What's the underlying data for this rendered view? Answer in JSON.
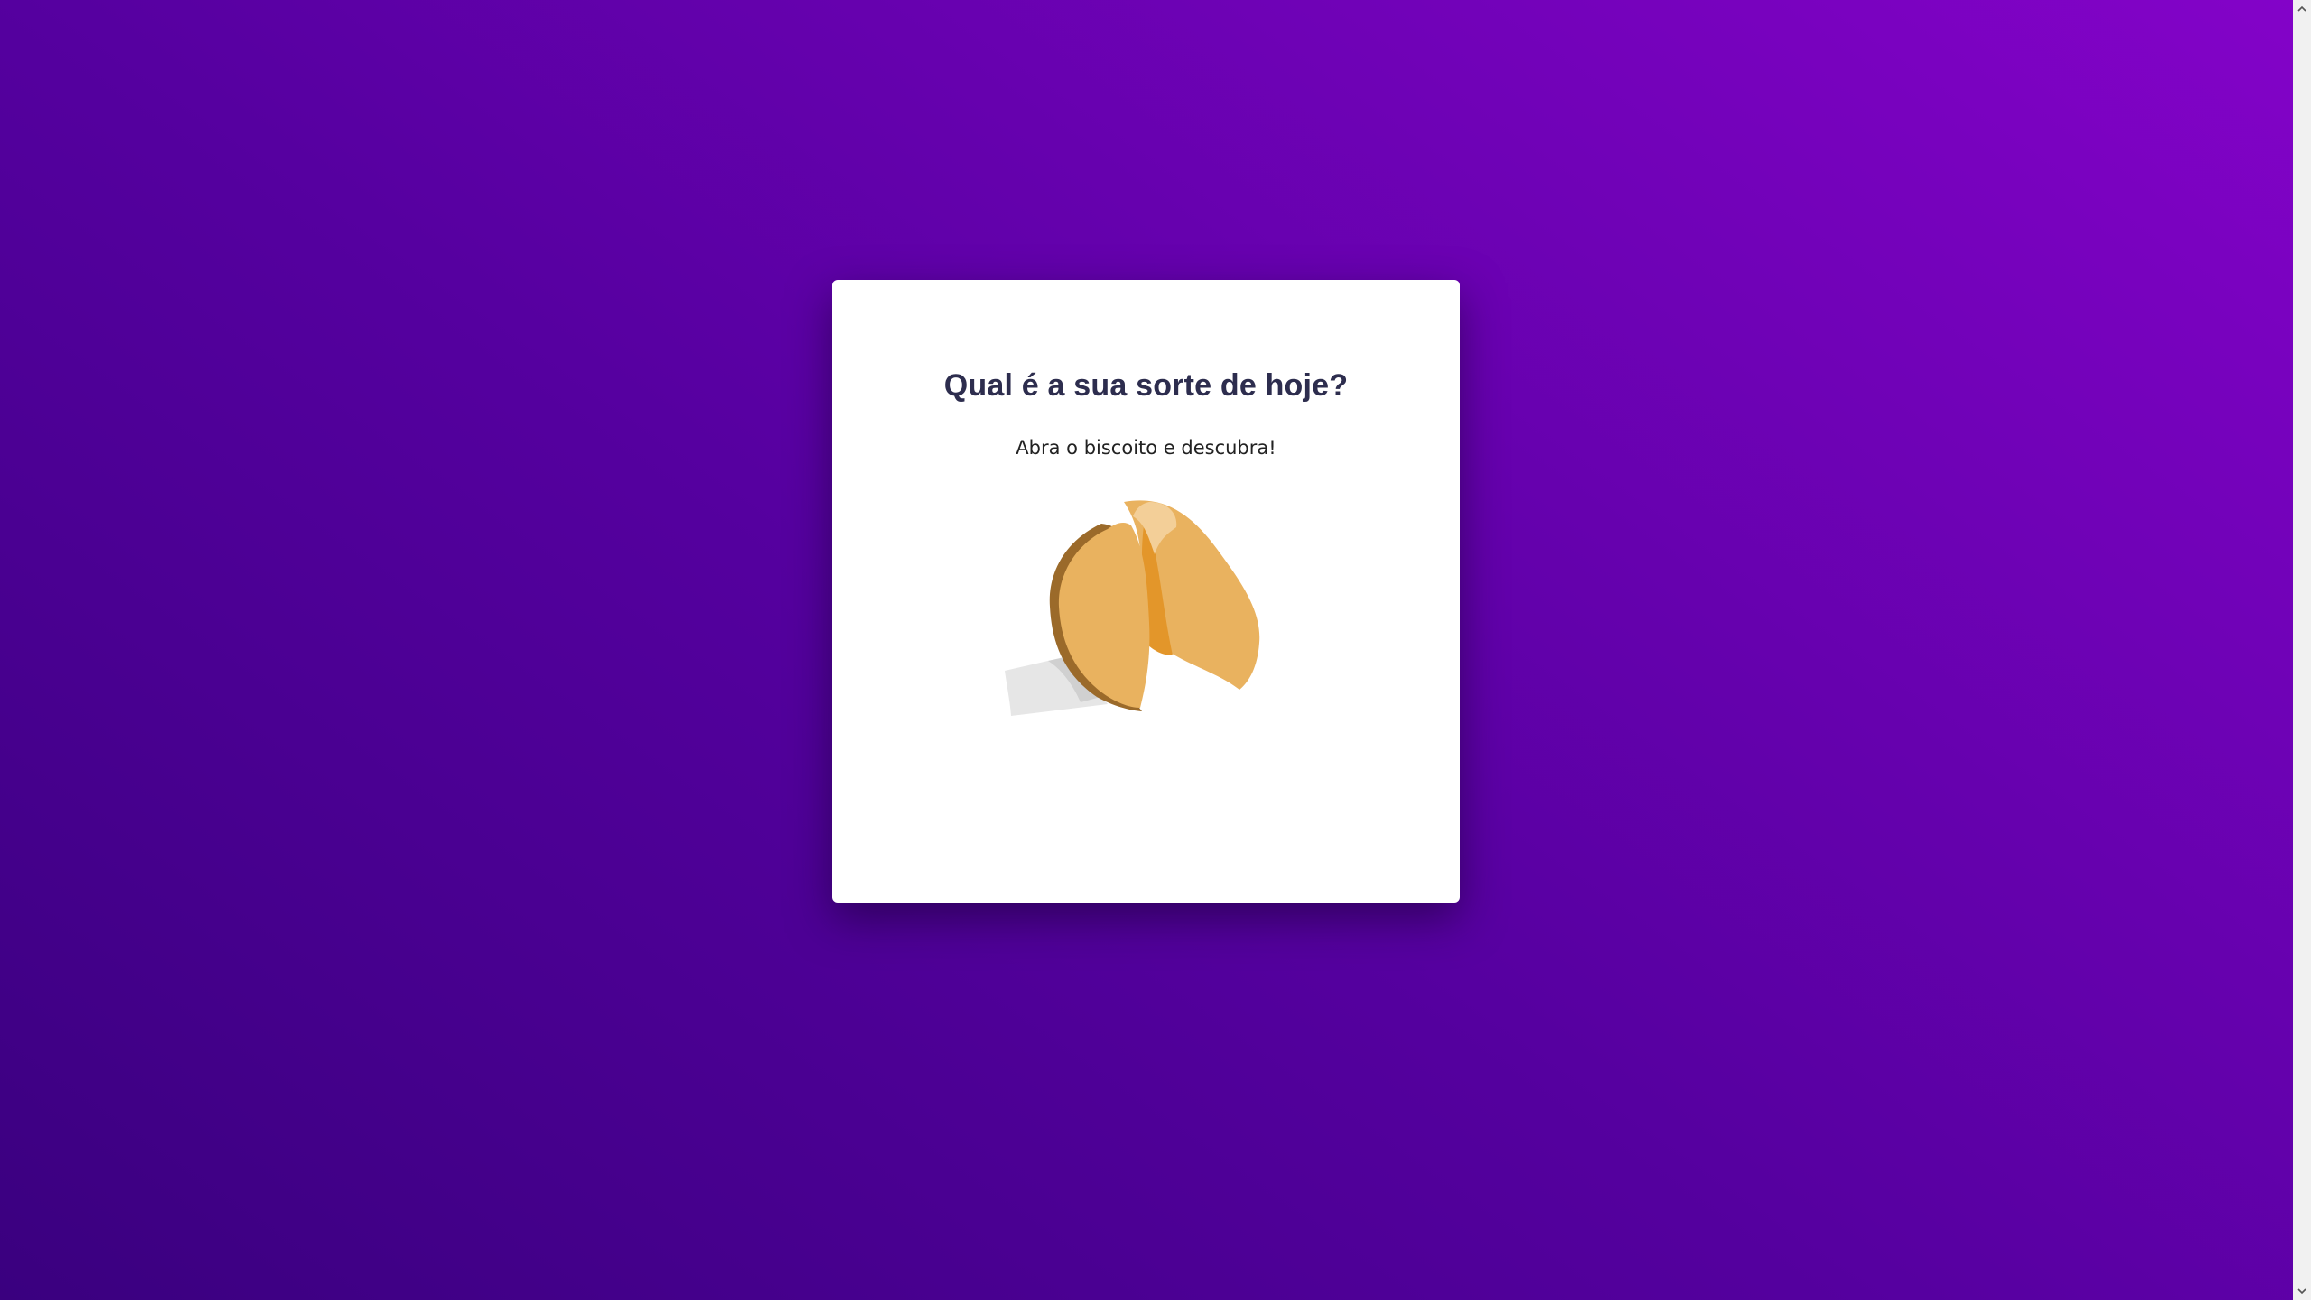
{
  "page": {
    "title": "Qual é a sua sorte de hoje?",
    "subtitle": "Abra o biscoito e descubra!"
  },
  "cookie": {
    "icon": "fortune-cookie-icon"
  },
  "colors": {
    "background_dark": "#3a007f",
    "background_light": "#8303c8",
    "card": "#ffffff",
    "title_text": "#2d2d4e",
    "cookie_main": "#e9b25f",
    "cookie_shadow": "#9b6a2a",
    "cookie_inner": "#e3962a",
    "paper": "#e6e6e6"
  }
}
